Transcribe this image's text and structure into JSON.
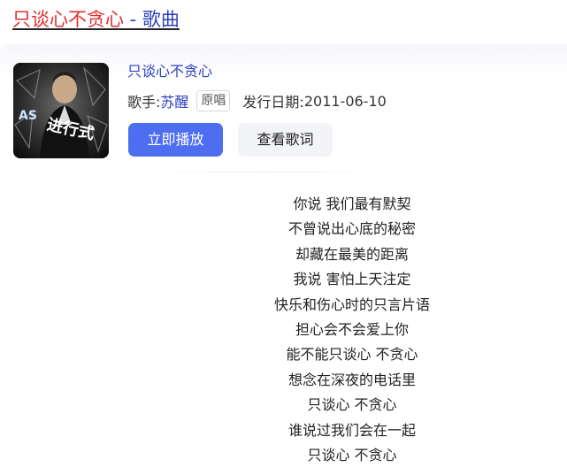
{
  "header": {
    "title_highlight": "只谈心不贪心",
    "title_rest": " - 歌曲"
  },
  "song": {
    "name": "只谈心不贪心",
    "cover_text": "进行式",
    "cover_logo": "AS",
    "singer_label": "歌手:",
    "singer_name": "苏醒",
    "badge": "原唱",
    "release_label": "发行日期:",
    "release_date": "2011-06-10"
  },
  "buttons": {
    "play": "立即播放",
    "lyrics": "查看歌词"
  },
  "lyrics": [
    "你说 我们最有默契",
    "不曾说出心底的秘密",
    "却藏在最美的距离",
    "我说 害怕上天注定",
    "快乐和伤心时的只言片语",
    "担心会不会爱上你",
    "能不能只谈心 不贪心",
    "想念在深夜的电话里",
    "只谈心 不贪心",
    "谁说过我们会在一起",
    "只谈心 不贪心"
  ],
  "colors": {
    "link": "#2b3fbf",
    "highlight": "#e03030",
    "primary_button": "#4e6ef2"
  }
}
